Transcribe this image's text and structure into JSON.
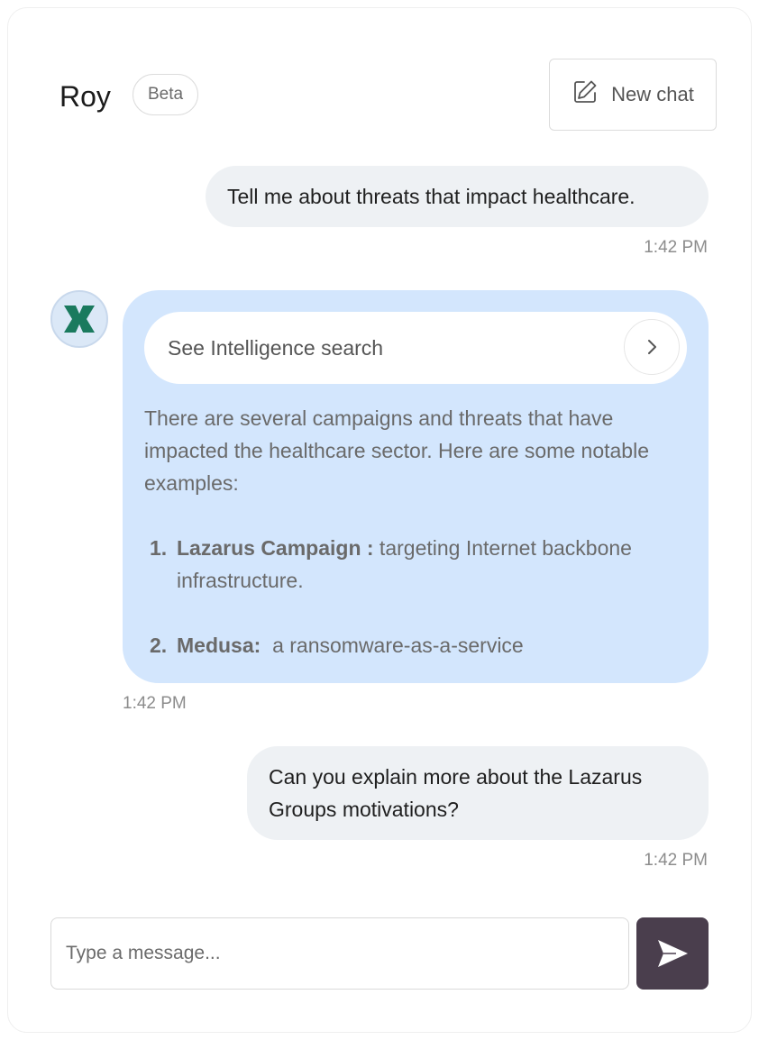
{
  "header": {
    "title": "Roy",
    "badge": "Beta",
    "new_chat_label": "New chat",
    "new_chat_icon": "edit-icon"
  },
  "messages": [
    {
      "role": "user",
      "text": "Tell me about threats that impact healthcare.",
      "time": "1:42 PM"
    },
    {
      "role": "assistant",
      "avatar_icon": "logo-icon",
      "intel_link": "See Intelligence search",
      "intro": "There are several campaigns and threats that have impacted the healthcare sector. Here are some notable examples:",
      "items": [
        {
          "num": "1.",
          "name": "Lazarus Campaign :",
          "desc": " targeting Internet backbone infrastructure."
        },
        {
          "num": "2.",
          "name": "Medusa:",
          "desc": "  a ransomware-as-a-service"
        }
      ],
      "time": "1:42 PM"
    },
    {
      "role": "user",
      "text": "Can you explain more about the Lazarus Groups motivations?",
      "time": "1:42 PM"
    }
  ],
  "composer": {
    "placeholder": "Type a message...",
    "send_icon": "send-icon"
  },
  "colors": {
    "user_bubble": "#eef1f4",
    "bot_bubble": "#d3e6fd",
    "send_button": "#4a3e4d",
    "logo": "#1a7a5e"
  }
}
